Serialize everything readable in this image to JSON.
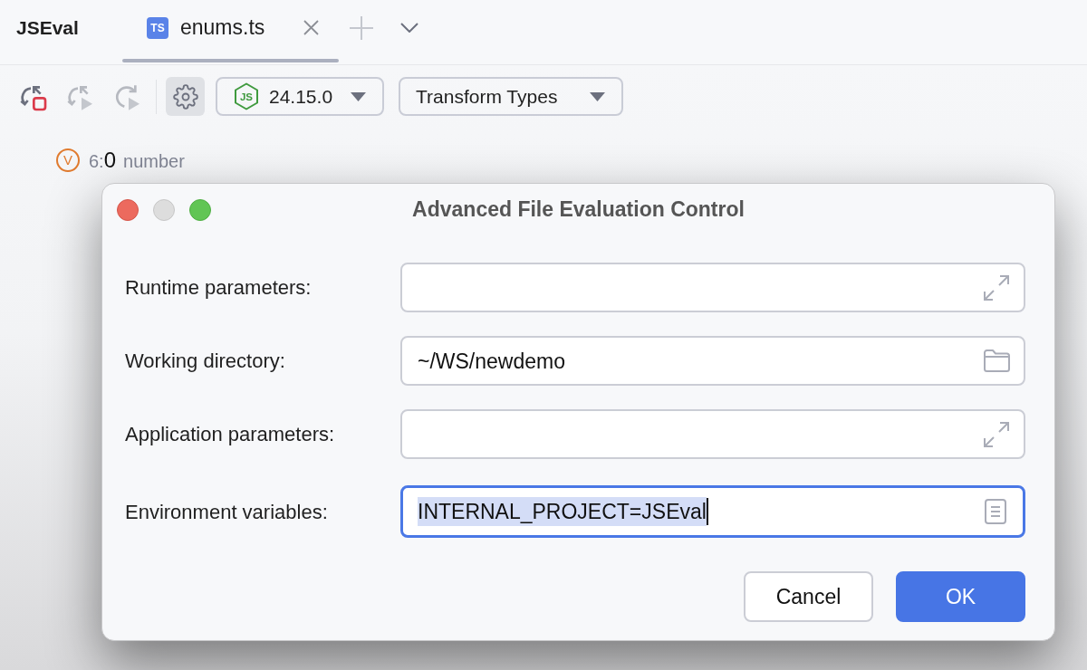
{
  "project": {
    "title": "JSEval"
  },
  "tabs": [
    {
      "file_type": "TS",
      "label": "enums.ts",
      "selected": true
    }
  ],
  "toolbar": {
    "actions": [
      {
        "kind": "rerun-stop",
        "disabled": false
      },
      {
        "kind": "rerun-play",
        "disabled": true
      },
      {
        "kind": "reload-play",
        "disabled": true
      }
    ],
    "settings": {
      "selected": true
    },
    "runtime": {
      "icon_text": "JS",
      "version": "24.15.0"
    },
    "mode": {
      "label": "Transform Types"
    }
  },
  "result": {
    "badge": "V",
    "position": "6:",
    "value": "0",
    "type": "number"
  },
  "dialog": {
    "title": "Advanced File Evaluation Control",
    "window_controls": [
      {
        "kind": "close",
        "disabled": false
      },
      {
        "kind": "minimize",
        "disabled": true
      },
      {
        "kind": "zoom",
        "disabled": false
      }
    ],
    "fields": [
      {
        "label": "Runtime parameters:",
        "kind": "expand",
        "focused": false
      },
      {
        "label": "Working directory:",
        "value": "~/WS/newdemo",
        "kind": "browse",
        "focused": false,
        "text_selected": false
      },
      {
        "label": "Application parameters:",
        "kind": "expand",
        "focused": false
      },
      {
        "label": "Environment variables:",
        "value": "INTERNAL_PROJECT=JSEval",
        "kind": "edit-list",
        "focused": true,
        "text_selected": true
      }
    ],
    "buttons": [
      {
        "label": "Cancel",
        "kind": "secondary"
      },
      {
        "label": "OK",
        "kind": "primary"
      }
    ]
  }
}
